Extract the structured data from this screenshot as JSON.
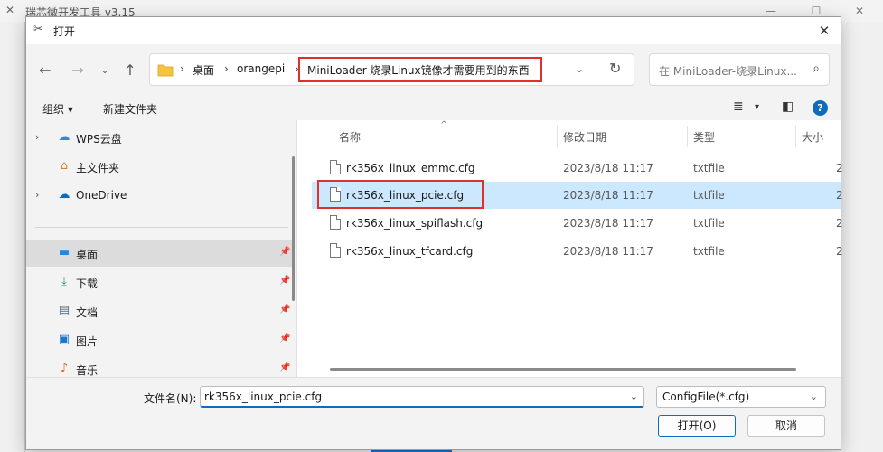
{
  "background_app": {
    "title": "瑞芯微开发工具 v3.15"
  },
  "dialog": {
    "title": "打开"
  },
  "address": {
    "crumbs": [
      "桌面",
      "orangepi",
      "MiniLoader-烧录Linux镜像才需要用到的东西"
    ],
    "search_placeholder": "在 MiniLoader-烧录Linux..."
  },
  "toolbar": {
    "organize_label": "组织 ▾",
    "new_folder_label": "新建文件夹"
  },
  "sidebar": {
    "items": [
      {
        "label": "WPS云盘",
        "icon": "cloud-icon"
      },
      {
        "label": "主文件夹",
        "icon": "home-icon"
      },
      {
        "label": "OneDrive",
        "icon": "onedrive-icon"
      },
      {
        "label": "桌面",
        "icon": "desktop-icon"
      },
      {
        "label": "下载",
        "icon": "download-icon"
      },
      {
        "label": "文档",
        "icon": "document-icon"
      },
      {
        "label": "图片",
        "icon": "picture-icon"
      },
      {
        "label": "音乐",
        "icon": "music-icon"
      }
    ]
  },
  "filelist": {
    "columns": [
      "名称",
      "修改日期",
      "类型",
      "大小"
    ],
    "rows": [
      {
        "name": "rk356x_linux_emmc.cfg",
        "date": "2023/8/18 11:17",
        "type": "txtfile",
        "size": "2"
      },
      {
        "name": "rk356x_linux_pcie.cfg",
        "date": "2023/8/18 11:17",
        "type": "txtfile",
        "size": "2"
      },
      {
        "name": "rk356x_linux_spiflash.cfg",
        "date": "2023/8/18 11:17",
        "type": "txtfile",
        "size": "2"
      },
      {
        "name": "rk356x_linux_tfcard.cfg",
        "date": "2023/8/18 11:17",
        "type": "txtfile",
        "size": "2"
      }
    ]
  },
  "bottom": {
    "filename_label": "文件名(N):",
    "filename_value": "rk356x_linux_pcie.cfg",
    "filetype_value": "ConfigFile(*.cfg)",
    "open_label": "打开(O)",
    "cancel_label": "取消"
  },
  "colors": {
    "accent": "#0f6cbd",
    "selection": "#cce8ff",
    "highlight_box": "#e0302a"
  }
}
